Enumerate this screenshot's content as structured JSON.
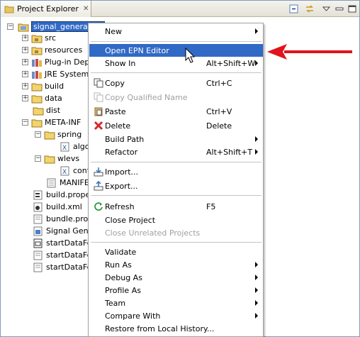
{
  "tab": {
    "title": "Project Explorer",
    "close": "✕"
  },
  "tree": {
    "project": "signal_generation",
    "items": [
      "src",
      "resources",
      "Plug-in Depe",
      "JRE System",
      "build",
      "data",
      "dist",
      "META-INF",
      "spring",
      "algo",
      "wlevs",
      "conf",
      "MANIFES",
      "build.proper",
      "build.xml",
      "bundle.prop",
      "Signal Gener",
      "startDataFe",
      "startDataFe",
      "startDataFe"
    ]
  },
  "menu": {
    "new": "New",
    "open_epn": "Open EPN Editor",
    "show_in": "Show In",
    "show_in_key": "Alt+Shift+W",
    "copy": "Copy",
    "copy_key": "Ctrl+C",
    "copy_qualified": "Copy Qualified Name",
    "paste": "Paste",
    "paste_key": "Ctrl+V",
    "delete": "Delete",
    "delete_key": "Delete",
    "build_path": "Build Path",
    "refactor": "Refactor",
    "refactor_key": "Alt+Shift+T",
    "import": "Import...",
    "export": "Export...",
    "refresh": "Refresh",
    "refresh_key": "F5",
    "close_project": "Close Project",
    "close_unrelated": "Close Unrelated Projects",
    "validate": "Validate",
    "run_as": "Run As",
    "debug_as": "Debug As",
    "profile_as": "Profile As",
    "team": "Team",
    "compare_with": "Compare With",
    "restore": "Restore from Local History..."
  },
  "colors": {
    "highlight": "#3169c6",
    "annotation_arrow": "#e0141c"
  }
}
